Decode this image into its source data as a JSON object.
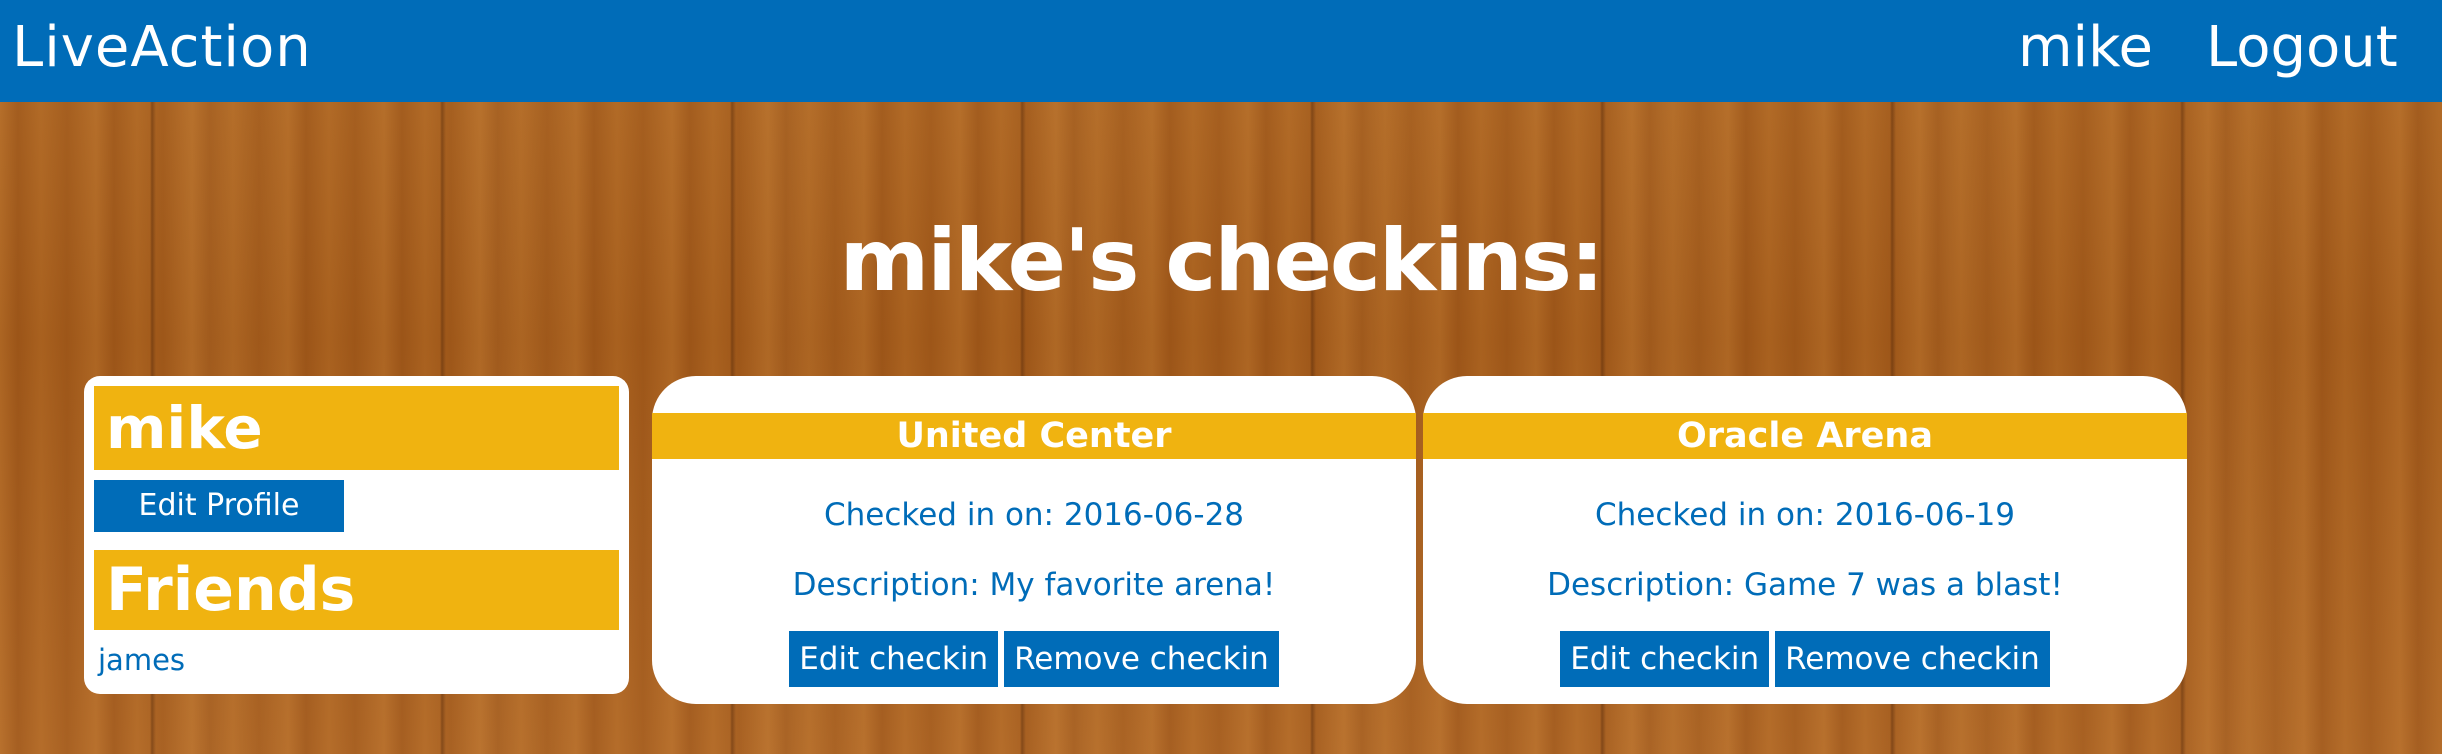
{
  "navbar": {
    "brand": "LiveAction",
    "user_link": "mike",
    "logout_link": "Logout"
  },
  "page": {
    "title": "mike's checkins:"
  },
  "profile": {
    "name": "mike",
    "edit_button": "Edit Profile",
    "friends_heading": "Friends",
    "friends": [
      "james"
    ]
  },
  "checkins": [
    {
      "venue": "United Center",
      "date_text": "Checked in on: 2016-06-28",
      "description_text": "Description: My favorite arena!",
      "edit_button": "Edit checkin",
      "remove_button": "Remove checkin"
    },
    {
      "venue": "Oracle Arena",
      "date_text": "Checked in on: 2016-06-19",
      "description_text": "Description: Game 7 was a blast!",
      "edit_button": "Edit checkin",
      "remove_button": "Remove checkin"
    }
  ],
  "colors": {
    "primary_blue": "#006cb8",
    "accent_yellow": "#f0b310",
    "wood_background": "#a8601e"
  }
}
